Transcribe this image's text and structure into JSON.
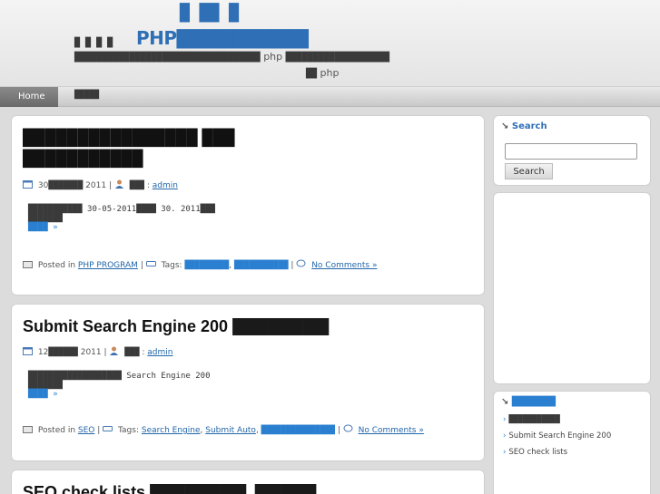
{
  "header": {
    "site_title": "PHP",
    "site_title_glyphs": "██████████████",
    "site_title_top": "█  ██  █",
    "tagline_line1_a": "█  █                                        █                  █",
    "tagline_line1_b": "██████████████████████████████████",
    "tagline_php_word": "php",
    "tagline_line1_c": "███████████████████",
    "tagline_line2_glyphs": "██",
    "tagline_php_word2": "php"
  },
  "nav": {
    "home": "Home",
    "item2": "█████"
  },
  "posts": [
    {
      "title_line1": "████████████████ ███",
      "title_line2": "███████████",
      "date": "30",
      "date_glyphs": "███████",
      "year": "2011",
      "author_label_glyphs": "███",
      "author": "admin",
      "excerpt_line1": "███████████  30-05-2011████  30.   2011███",
      "excerpt_line2": "███████",
      "excerpt_more": "████ »",
      "posted_in": "Posted in",
      "category": "PHP PROGRAM",
      "tags_label": "Tags:",
      "tag1": "█████████",
      "tag2": "███████████",
      "comments": "No Comments »"
    },
    {
      "title_text": "Submit Search Engine 200",
      "title_glyphs": "███████████",
      "date": "12",
      "date_glyphs": "██████",
      "year": "2011",
      "author_label_glyphs": "███",
      "author": "admin",
      "excerpt_line1": "███████████████████    Search    Engine   200",
      "excerpt_line2": "███████",
      "excerpt_more": "████ »",
      "posted_in": "Posted in",
      "category": "SEO",
      "tags_label": "Tags:",
      "tag1": "Search Engine",
      "tag2": "Submit Auto",
      "tag3": "███████████████",
      "comments": "No Comments »"
    },
    {
      "title_text": "SEO check lists",
      "title_glyphs": "███████████ ███████"
    }
  ],
  "sidebar": {
    "search_title": "Search",
    "search_button": "Search",
    "recent_title_glyphs": "████████",
    "recent_items": [
      "███████████",
      "Submit Search Engine 200",
      "SEO check lists"
    ]
  },
  "colors": {
    "brand_blue": "#2f6fb6",
    "link_blue": "#2266aa"
  }
}
